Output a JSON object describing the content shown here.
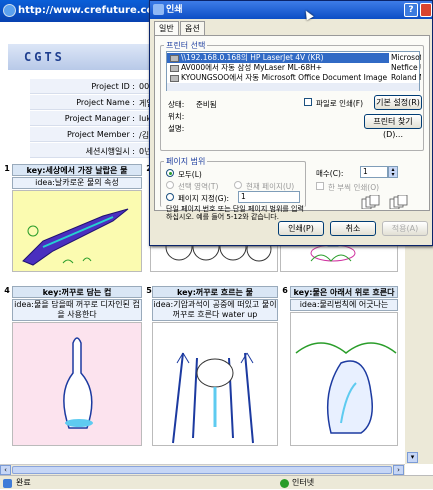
{
  "browser": {
    "title": "http://www.crefuture.com -",
    "status_text": "완료",
    "zone_text": "인터넷"
  },
  "page": {
    "logo": "CGTS",
    "info": [
      {
        "label": "Project ID :",
        "value": "00288"
      },
      {
        "label": "Project Name :",
        "value": "게임 시나리"
      },
      {
        "label": "Project Manager :",
        "value": "luke1733"
      },
      {
        "label": "Project Member :",
        "value": "/김향명/김"
      },
      {
        "label": "세션시행일시 :",
        "value": "0년0월0일0"
      }
    ],
    "cells": [
      {
        "num": "1",
        "key": "key:세상에서 가장 날랍은 물",
        "idea": "idea:날카로운 물의 속성"
      },
      {
        "num": "2",
        "key": "",
        "idea": ""
      },
      {
        "num": "4",
        "key": "key:꺼꾸로 담는 컵",
        "idea": "idea:물을 담을때 꺼꾸로 디자인된 컵을 사용한다"
      },
      {
        "num": "5",
        "key": "key:꺼꾸로 흐르는 물",
        "idea": "idea:기압과석이 공중에 떠있고 물이 꺼꾸로 흐른다 water up"
      },
      {
        "num": "6",
        "key": "key:물은 아래서 위로 흐른다",
        "idea": "idea:물리법칙에 어긋나는"
      }
    ]
  },
  "dialog": {
    "title": "인쇄",
    "help": "?",
    "tabs": [
      "일반",
      "옵션"
    ],
    "printer_group": "프린터 선택",
    "printers": [
      "\\\\192.168.0.168의 HP LaserJet 4V (KR)",
      "AV000에서 자동 삼성 MyLaser ML-68H+",
      "KYOUNGSOO에서 자동 Microsoft Office Document Image Writer"
    ],
    "printers_right": [
      "Microsoft",
      "Netfice Ul",
      "Roland M("
    ],
    "status_label": "상태:",
    "status_value": "준비됨",
    "location_label": "위치:",
    "comment_label": "설명:",
    "print_to_file": "파일로 인쇄(F)",
    "preferences_btn": "기본 설정(R)",
    "find_printer_btn": "프린터 찾기(D)...",
    "range_group": "페이지 범위",
    "range_all": "모두(L)",
    "range_selection": "선택 영역(T)",
    "range_current": "현재 페이지(U)",
    "range_pages": "페이지 지정(G):",
    "range_pages_value": "1",
    "range_hint": "단일 페이지 번호 또는 단일 페이지 범위를 입력하십시오. 예를 들어 5-12와 같습니다.",
    "copies_label": "매수(C):",
    "copies_value": "1",
    "collate_label": "한 부씩 인쇄(O)",
    "print_btn": "인쇄(P)",
    "cancel_btn": "취소",
    "apply_btn": "적용(A)"
  }
}
